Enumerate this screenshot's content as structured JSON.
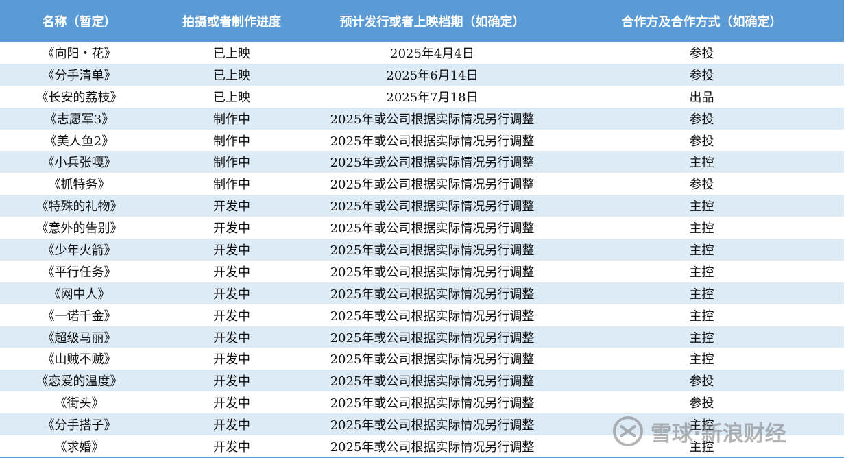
{
  "colors": {
    "header_bg": "#5b9bd5",
    "header_text": "#ffffff",
    "stripe": "#ddebf7",
    "body_text": "#111111"
  },
  "table": {
    "headers": [
      "名称（暂定）",
      "拍摄或者制作进度",
      "预计发行或者上映档期（如确定）",
      "合作方及合作方式（如确定）"
    ],
    "rows": [
      [
        "《向阳・花》",
        "已上映",
        "2025年4月4日",
        "参投"
      ],
      [
        "《分手清单》",
        "已上映",
        "2025年6月14日",
        "参投"
      ],
      [
        "《长安的荔枝》",
        "已上映",
        "2025年7月18日",
        "出品"
      ],
      [
        "《志愿军3》",
        "制作中",
        "2025年或公司根据实际情况另行调整",
        "参投"
      ],
      [
        "《美人鱼2》",
        "制作中",
        "2025年或公司根据实际情况另行调整",
        "参投"
      ],
      [
        "《小兵张嘎》",
        "制作中",
        "2025年或公司根据实际情况另行调整",
        "主控"
      ],
      [
        "《抓特务》",
        "制作中",
        "2025年或公司根据实际情况另行调整",
        "参投"
      ],
      [
        "《特殊的礼物》",
        "开发中",
        "2025年或公司根据实际情况另行调整",
        "主控"
      ],
      [
        "《意外的告别》",
        "开发中",
        "2025年或公司根据实际情况另行调整",
        "主控"
      ],
      [
        "《少年火箭》",
        "开发中",
        "2025年或公司根据实际情况另行调整",
        "主控"
      ],
      [
        "《平行任务》",
        "开发中",
        "2025年或公司根据实际情况另行调整",
        "主控"
      ],
      [
        "《网中人》",
        "开发中",
        "2025年或公司根据实际情况另行调整",
        "主控"
      ],
      [
        "《一诺千金》",
        "开发中",
        "2025年或公司根据实际情况另行调整",
        "主控"
      ],
      [
        "《超级马丽》",
        "开发中",
        "2025年或公司根据实际情况另行调整",
        "主控"
      ],
      [
        "《山贼不贼》",
        "开发中",
        "2025年或公司根据实际情况另行调整",
        "主控"
      ],
      [
        "《恋爱的温度》",
        "开发中",
        "2025年或公司根据实际情况另行调整",
        "参投"
      ],
      [
        "《街头》",
        "开发中",
        "2025年或公司根据实际情况另行调整",
        "参投"
      ],
      [
        "《分手搭子》",
        "开发中",
        "2025年或公司根据实际情况另行调整",
        "主控"
      ],
      [
        "《求婚》",
        "开发中",
        "2025年或公司根据实际情况另行调整",
        "主控"
      ]
    ]
  },
  "watermark": {
    "icon": "snowball-logo-icon",
    "text": "雪球·新浪财经"
  }
}
